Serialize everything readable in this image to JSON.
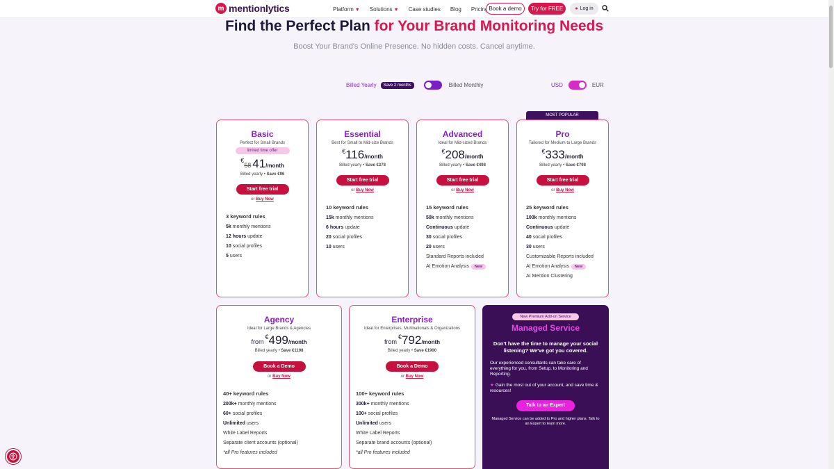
{
  "nav": {
    "logo_text": "mentionlytics",
    "links": [
      {
        "label": "Platform",
        "caret": true
      },
      {
        "label": "Solutions",
        "caret": true
      },
      {
        "label": "Case studies",
        "caret": false
      },
      {
        "label": "Blog",
        "caret": false
      },
      {
        "label": "Pricing",
        "caret": false
      }
    ],
    "book_demo": "Book a demo",
    "try_free": "Try for FREE",
    "login": "Log in"
  },
  "hero": {
    "title_main": "Find the Perfect Plan ",
    "title_accent": "for Your Brand Monitoring Needs",
    "subtitle": "Boost Your Brand's Online Presence. No hidden costs. Cancel anytime."
  },
  "billing": {
    "yearly": "Billed Yearly",
    "save_badge": "Save 2 months",
    "monthly": "Billed Monthly",
    "usd": "USD",
    "eur": "EUR"
  },
  "most_popular": "MOST POPULAR",
  "plans": [
    {
      "name": "Basic",
      "tagline": "Perfect for Small Brands",
      "offer": "limited time offer",
      "currency": "€",
      "old_price": "58",
      "price": "41",
      "per": "/month",
      "billed": "Billed yearly",
      "save": "Save €96",
      "cta": "Start free trial",
      "or": "or",
      "buy": "Buy Now",
      "features": [
        {
          "label": "3 keyword rules",
          "head": true
        },
        {
          "bold": "5k",
          "rest": " monthly mentions"
        },
        {
          "bold": "12 hours",
          "rest": " update"
        },
        {
          "bold": "10",
          "rest": " social profiles"
        },
        {
          "bold": "5",
          "rest": " users"
        }
      ]
    },
    {
      "name": "Essential",
      "tagline": "Best for Small to Mid-size Brands",
      "currency": "€",
      "price": "116",
      "per": "/month",
      "billed": "Billed yearly",
      "save": "Save €278",
      "cta": "Start free trial",
      "or": "or",
      "buy": "Buy Now",
      "features": [
        {
          "label": "10 keyword rules",
          "head": true
        },
        {
          "bold": "15k",
          "rest": " monthly mentions"
        },
        {
          "bold": "6 hours",
          "rest": " update"
        },
        {
          "bold": "20",
          "rest": " social profiles"
        },
        {
          "bold": "10",
          "rest": " users"
        }
      ]
    },
    {
      "name": "Advanced",
      "tagline": "Ideal for Mid-sized Brands",
      "currency": "€",
      "price": "208",
      "per": "/month",
      "billed": "Billed yearly",
      "save": "Save €498",
      "cta": "Start free trial",
      "or": "or",
      "buy": "Buy Now",
      "features": [
        {
          "label": "15 keyword rules",
          "head": true
        },
        {
          "bold": "50k",
          "rest": " monthly mentions"
        },
        {
          "bold": "Continuous",
          "rest": " update"
        },
        {
          "bold": "30",
          "rest": " social profiles"
        },
        {
          "bold": "20",
          "rest": " users"
        },
        {
          "label": "Standard Reports included"
        },
        {
          "label": "AI Emotion Analysis",
          "badge": "New"
        }
      ]
    },
    {
      "name": "Pro",
      "tagline": "Tailored for Medium to Large Brands",
      "currency": "€",
      "price": "333",
      "per": "/month",
      "billed": "Billed yearly",
      "save": "Save €798",
      "cta": "Start free trial",
      "or": "or",
      "buy": "Buy Now",
      "features": [
        {
          "label": "25 keyword rules",
          "head": true
        },
        {
          "bold": "100k",
          "rest": " monthly mentions"
        },
        {
          "bold": "Continuous",
          "rest": " update"
        },
        {
          "bold": "40",
          "rest": " social profiles"
        },
        {
          "bold": "30",
          "rest": " users"
        },
        {
          "label": "Customizable Reports included"
        },
        {
          "label": "AI Emotion Analysis",
          "badge": "New"
        },
        {
          "label": "AI Mention Clustering"
        }
      ]
    },
    {
      "name": "Agency",
      "tagline": "Ideal for Large Brands & Agencies",
      "from": "from",
      "currency": "€",
      "price": "499",
      "per": "/month",
      "billed": "Billed yearly",
      "save": "Save €1198",
      "cta": "Book a Demo",
      "or": "or",
      "buy": "Buy Now",
      "features": [
        {
          "label": "40+ keyword rules",
          "head": true
        },
        {
          "bold": "200k+",
          "rest": " monthly mentions"
        },
        {
          "bold": "60+",
          "rest": " social profiles"
        },
        {
          "bold": "Unlimited",
          "rest": " users"
        },
        {
          "label": "White Label Reports"
        },
        {
          "label": "Separate client accounts (optional)"
        },
        {
          "label": "*all Pro features included",
          "italic": true
        }
      ]
    },
    {
      "name": "Enterprise",
      "tagline": "Ideal for Enterprises, Multinationals & Organizations",
      "from": "from",
      "currency": "€",
      "price": "792",
      "per": "/month",
      "billed": "Billed yearly",
      "save": "Save €1900",
      "cta": "Book a Demo",
      "or": "or",
      "buy": "Buy Now",
      "features": [
        {
          "label": "100+ keyword rules",
          "head": true
        },
        {
          "bold": "300k+",
          "rest": " monthly mentions"
        },
        {
          "bold": "100+",
          "rest": " social profiles"
        },
        {
          "bold": "Unlimited",
          "rest": " users"
        },
        {
          "label": "White Label Reports"
        },
        {
          "label": "Separate brand accounts (optional)"
        },
        {
          "label": "*all Pro features included",
          "italic": true
        }
      ]
    }
  ],
  "managed": {
    "pill": "New Premium Add-on Service",
    "title": "Managed Service",
    "question": "Don't have the time to manage your social listening? We've got you covered.",
    "desc": "Our experienced consultants can take care of everything for you, from Setup, to Monitoring and Reporting.",
    "gain": "Gain the most out of your account, and save time & resources!",
    "cta": "Talk to an Expert",
    "note": "Managed Service can be added to Pro and higher plans. Talk to an Expert to learn more."
  }
}
